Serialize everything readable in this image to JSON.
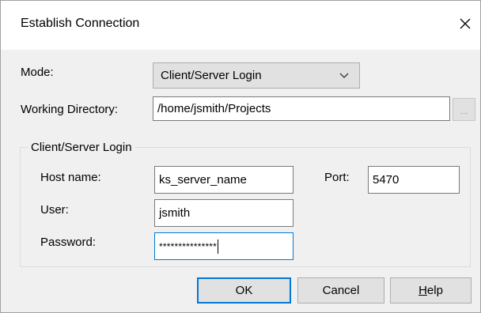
{
  "dialog": {
    "title": "Establish Connection",
    "close_icon": "close-icon"
  },
  "mode": {
    "label": "Mode:",
    "selected": "Client/Server Login"
  },
  "working_directory": {
    "label": "Working Directory:",
    "value": "/home/jsmith/Projects",
    "browse_label": "..."
  },
  "login_group": {
    "title": "Client/Server Login",
    "host": {
      "label": "Host name:",
      "value": "ks_server_name"
    },
    "port": {
      "label": "Port:",
      "value": "5470"
    },
    "user": {
      "label": "User:",
      "value": "jsmith"
    },
    "password": {
      "label": "Password:",
      "value": "***************"
    }
  },
  "buttons": {
    "ok": "OK",
    "cancel": "Cancel",
    "help_mnemonic": "H",
    "help_rest": "elp"
  },
  "colors": {
    "focus_accent": "#0078d7",
    "dialog_bg": "#f0f0f0"
  }
}
